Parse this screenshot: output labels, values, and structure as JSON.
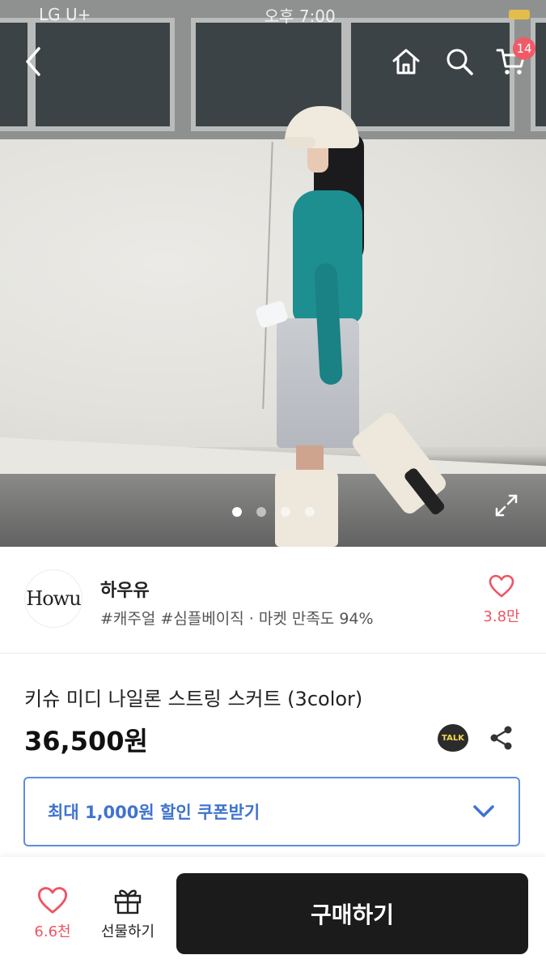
{
  "status_bar": {
    "carrier": "LG U+",
    "time": "오후 7:00"
  },
  "nav": {
    "back_icon": "chevron-left-icon",
    "home_icon": "home-icon",
    "search_icon": "search-icon",
    "cart_icon": "cart-icon",
    "cart_count": "14"
  },
  "gallery": {
    "total_images": 4,
    "active_index": 0
  },
  "shop": {
    "logo_text": "Howu",
    "name": "하우유",
    "tags": "#캐주얼 #심플베이직 · 마켓 만족도 94%",
    "like_count": "3.8만"
  },
  "product": {
    "name": "키슈 미디 나일론 스트링 스커트 (3color)",
    "price": "36,500원",
    "kakao_label": "TALK"
  },
  "coupon": {
    "label": "최대 1,000원 할인 쿠폰받기"
  },
  "bottom_bar": {
    "like_count": "6.6천",
    "gift_label": "선물하기",
    "buy_label": "구매하기"
  },
  "colors": {
    "accent_red": "#ef5463",
    "coupon_blue": "#3f73cf",
    "buy_bg": "#1b1b1b"
  }
}
